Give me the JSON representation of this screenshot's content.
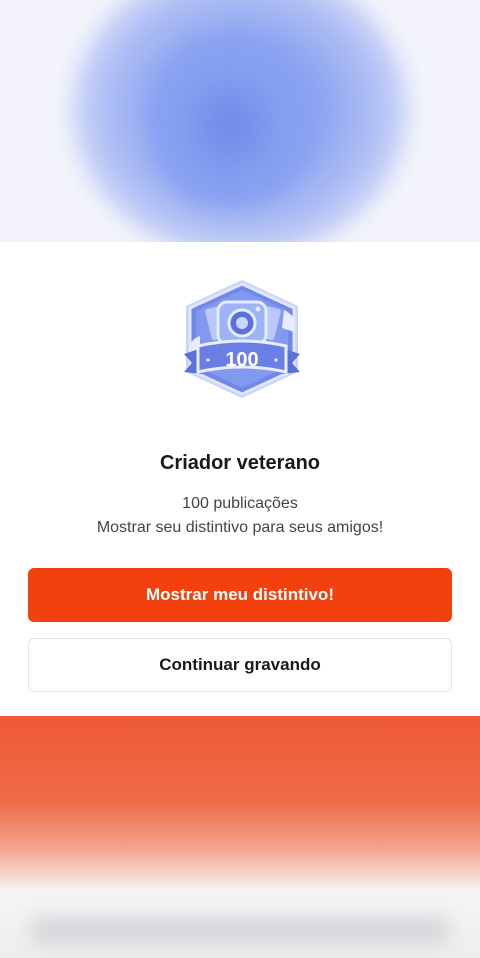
{
  "badge": {
    "number": "100",
    "icon": "camera-badge-icon"
  },
  "modal": {
    "title": "Criador veterano",
    "subtitle": "100 publicações",
    "description": "Mostrar seu distintivo para seus amigos!",
    "primary_button": "Mostrar meu distintivo!",
    "secondary_button": "Continuar gravando"
  },
  "colors": {
    "primary_button": "#f2400e",
    "badge_main": "#6a7fe6",
    "backdrop_top": "#8ea6f1",
    "backdrop_bottom": "#ee5a35"
  }
}
